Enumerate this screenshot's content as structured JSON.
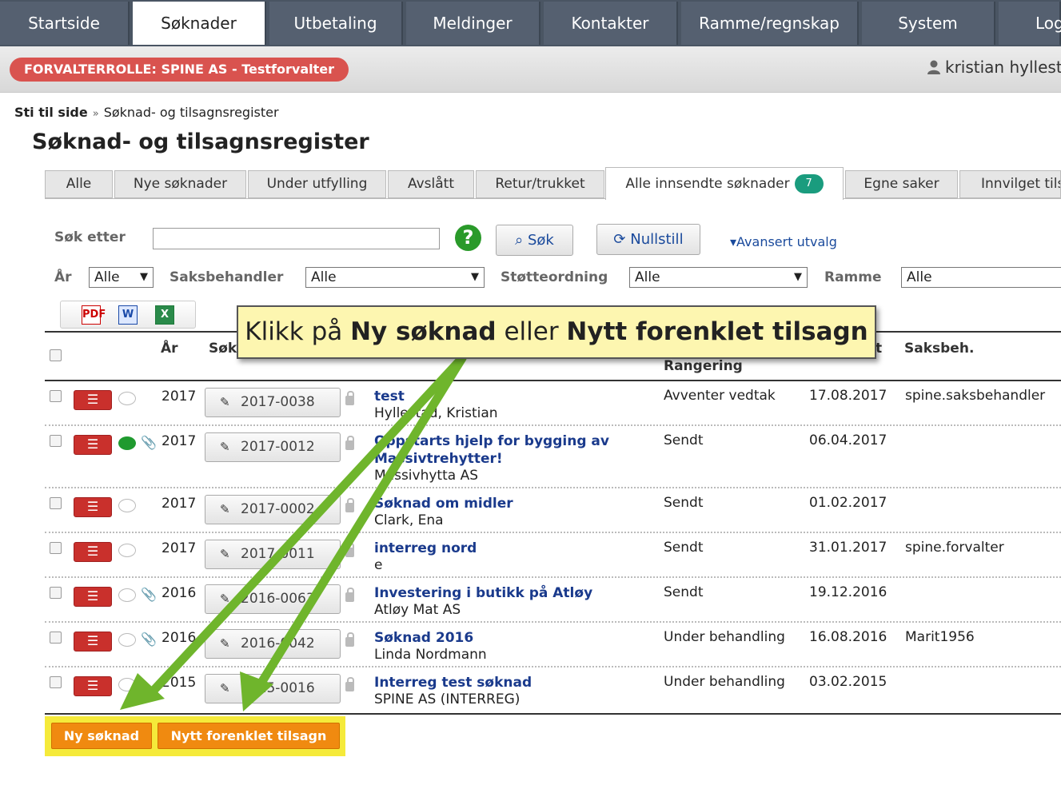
{
  "topnav": {
    "tabs": [
      "Startside",
      "Søknader",
      "Utbetaling",
      "Meldinger",
      "Kontakter",
      "Ramme/regnskap",
      "System",
      "Log"
    ],
    "active": "Søknader"
  },
  "rolebar": {
    "role": "FORVALTERROLLE: SPINE AS - Testforvalter",
    "user": "kristian hyllesta"
  },
  "breadcrumb": {
    "label": "Sti til side",
    "separator": "»",
    "current": "Søknad- og tilsagnsregister"
  },
  "page_title": "Søknad- og tilsagnsregister",
  "subtabs": {
    "items": [
      "Alle",
      "Nye søknader",
      "Under utfylling",
      "Avslått",
      "Retur/trukket",
      "Alle innsendte søknader",
      "Egne saker",
      "Innvilget tilsa"
    ],
    "active": "Alle innsendte søknader",
    "active_count": "7"
  },
  "search": {
    "label": "Søk etter",
    "value": "",
    "help": "?",
    "search_button": "Søk",
    "reset_button": "Nullstill",
    "advanced": "Avansert utvalg"
  },
  "filters": {
    "year_label": "År",
    "year_value": "Alle",
    "handler_label": "Saksbehandler",
    "handler_value": "Alle",
    "scheme_label": "Støtteordning",
    "scheme_value": "Alle",
    "frame_label": "Ramme",
    "frame_value": "Alle"
  },
  "export": {
    "pdf": "PDF",
    "word": "W",
    "excel": "X"
  },
  "table": {
    "headers": {
      "year": "År",
      "case": "Søk",
      "status_hidden": "t",
      "ranking": "Rangering",
      "handler": "Saksbeh."
    },
    "rows": [
      {
        "year": "2017",
        "case": "2017-0038",
        "title": "test",
        "applicant": "Hyllestad, Kristian",
        "status": "Avventer vedtak",
        "date": "17.08.2017",
        "handler": "spine.saksbehandler",
        "comment": "empty",
        "attachment": false
      },
      {
        "year": "2017",
        "case": "2017-0012",
        "title": "Oppstarts hjelp for bygging av Massivtrehytter!",
        "applicant": "Massivhytta AS",
        "status": "Sendt",
        "date": "06.04.2017",
        "handler": "",
        "comment": "green",
        "attachment": true
      },
      {
        "year": "2017",
        "case": "2017-0002",
        "title": "Søknad om midler",
        "applicant": "Clark, Ena",
        "status": "Sendt",
        "date": "01.02.2017",
        "handler": "",
        "comment": "empty",
        "attachment": false
      },
      {
        "year": "2017",
        "case": "2017-0011",
        "title": "interreg nord",
        "applicant": "e",
        "status": "Sendt",
        "date": "31.01.2017",
        "handler": "spine.forvalter",
        "comment": "empty",
        "attachment": false
      },
      {
        "year": "2016",
        "case": "2016-0063",
        "title": "Investering i butikk på Atløy",
        "applicant": "Atløy Mat AS",
        "status": "Sendt",
        "date": "19.12.2016",
        "handler": "",
        "comment": "empty",
        "attachment": true
      },
      {
        "year": "2016",
        "case": "2016-0042",
        "title": "Søknad 2016",
        "applicant": "Linda Nordmann",
        "status": "Under behandling",
        "date": "16.08.2016",
        "handler": "Marit1956",
        "comment": "empty",
        "attachment": true
      },
      {
        "year": "2015",
        "case": "2015-0016",
        "title": "Interreg test søknad",
        "applicant": "SPINE AS (INTERREG)",
        "status": "Under behandling",
        "date": "03.02.2015",
        "handler": "",
        "comment": "empty",
        "attachment": false
      }
    ]
  },
  "actions": {
    "new_application": "Ny søknad",
    "new_simplified": "Nytt forenklet tilsagn"
  },
  "callout": {
    "prefix": "Klikk på ",
    "bold1": "Ny søknad",
    "middle": " eller ",
    "bold2": "Nytt forenklet tilsagn"
  },
  "colors": {
    "nav_bg": "#4a5563",
    "role_badge": "#d9534f",
    "link": "#1a3a8c",
    "action_orange": "#f08a10",
    "highlight_yellow": "#f5ea3a",
    "arrow_green": "#6fb52c"
  }
}
